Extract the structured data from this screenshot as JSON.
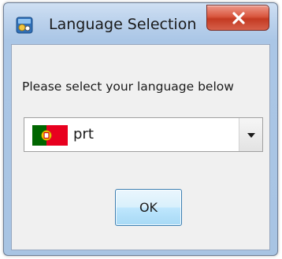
{
  "window": {
    "title": "Language Selection",
    "app_icon": "application-icon",
    "close_icon": "close-icon"
  },
  "dialog": {
    "prompt": "Please select your language below",
    "language_select": {
      "selected_value": "prt",
      "flag_icon": "portugal-flag-icon",
      "arrow_icon": "chevron-down-icon"
    },
    "ok_label": "OK"
  },
  "colors": {
    "title_bar": "#bcd2ec",
    "close_button": "#c43a22",
    "client_area": "#f0f0f0",
    "ok_button": "#bee6fd",
    "flag_green": "#006600",
    "flag_red": "#e8001f"
  }
}
